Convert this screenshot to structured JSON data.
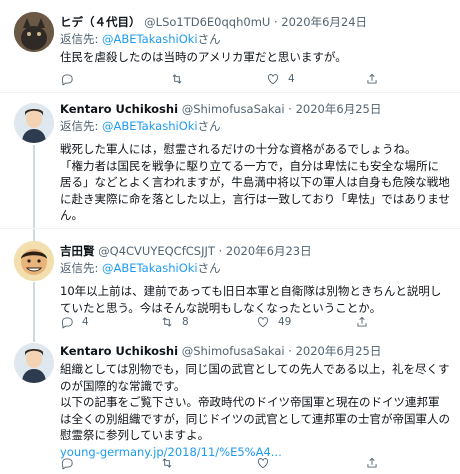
{
  "tweets": [
    {
      "name": "ヒデ（４代目）",
      "handle": "@LSo1TD6E0qqh0mU",
      "date": "2020年6月24日",
      "reply_prefix": "返信先: ",
      "reply_to": "@ABETakashiOki",
      "reply_suffix": "さん",
      "lines": [
        "住民を虐殺したのは当時のアメリカ軍だと思いますが。"
      ],
      "link": "",
      "counts": {
        "reply": "",
        "retweet": "",
        "like": "4",
        "share": ""
      }
    },
    {
      "name": "Kentaro Uchikoshi",
      "handle": "@ShimofusaSakai",
      "date": "2020年6月25日",
      "reply_prefix": "返信先: ",
      "reply_to": "@ABETakashiOki",
      "reply_suffix": "さん",
      "lines": [
        "戦死した軍人には，慰霊されるだけの十分な資格があるでしょうね。",
        "「権力者は国民を戦争に駆り立てる一方で，自分は卑怯にも安全な場所に居る」などとよく言われますが，牛島満中将以下の軍人は自身も危険な戦地に赴き実際に命を落とした以上，言行は一致しており「卑怯」ではありません。"
      ],
      "link": "",
      "counts": {
        "reply": "",
        "retweet": "",
        "like": "",
        "share": ""
      }
    },
    {
      "name": "吉田賢",
      "handle": "@Q4CVUYEQCfCSJJT",
      "date": "2020年6月23日",
      "reply_prefix": "返信先: ",
      "reply_to": "@ABETakashiOki",
      "reply_suffix": "さん",
      "lines": [
        "10年以上前は、建前であっても旧日本軍と自衛隊は別物ときちんと説明していたと思う。今はそんな説明もしなくなったということか。"
      ],
      "link": "",
      "counts": {
        "reply": "4",
        "retweet": "8",
        "like": "49",
        "share": ""
      }
    },
    {
      "name": "Kentaro Uchikoshi",
      "handle": "@ShimofusaSakai",
      "date": "2020年6月25日",
      "reply_prefix": "",
      "reply_to": "",
      "reply_suffix": "",
      "lines": [
        "組織としては別物でも，同じ国の武官としての先人である以上，礼を尽くすのが国際的な常識です。",
        "以下の記事をご覧下さい。帝政時代のドイツ帝国軍と現在のドイツ連邦軍は全くの別組織ですが，同じドイツの武官として連邦軍の士官が帝国軍人の慰霊祭に参列していますよ。"
      ],
      "link": "young-germany.jp/2018/11/%E5%A4...",
      "counts": {
        "reply": "",
        "retweet": "",
        "like": "",
        "share": ""
      }
    }
  ],
  "icons": [
    "reply-icon",
    "retweet-icon",
    "like-icon",
    "share-icon"
  ]
}
